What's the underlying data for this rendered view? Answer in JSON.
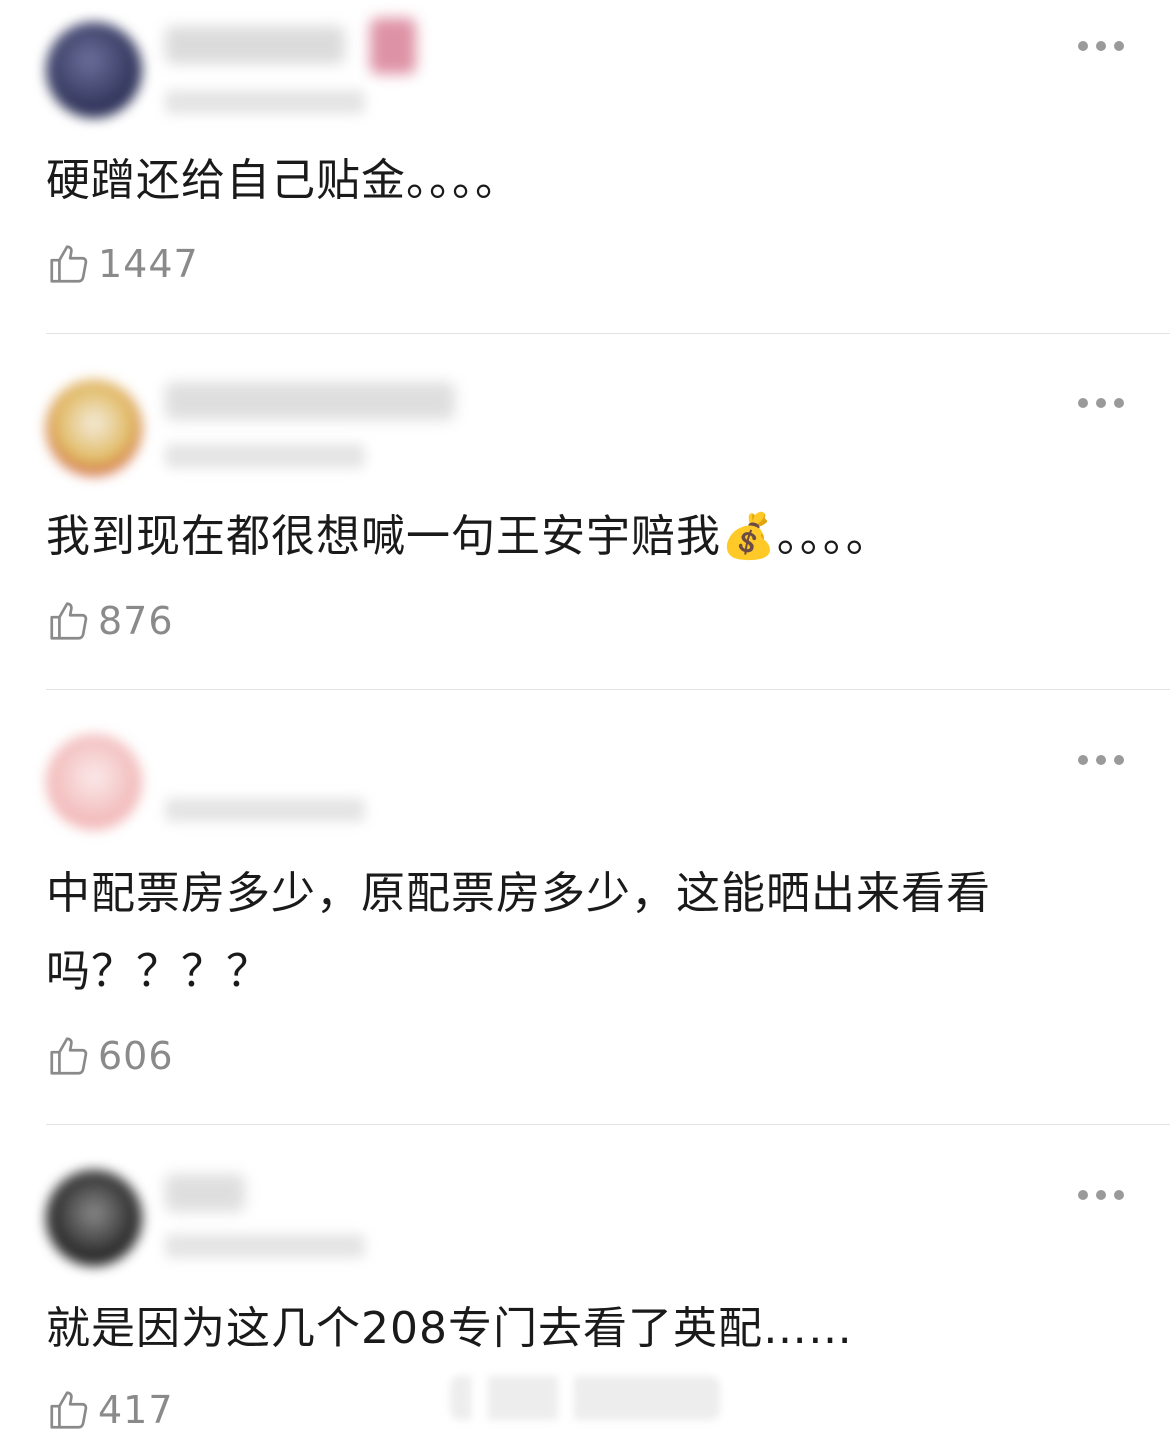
{
  "comments": [
    {
      "text": "硬蹭还给自己贴金。。。。",
      "likes": "1447",
      "more_icon": "more-horizontal-icon",
      "avatar_color": "#3a3f6b"
    },
    {
      "text": "我到现在都很想喊一句王安宇赔我💰。。。。",
      "likes": "876",
      "more_icon": "more-horizontal-icon",
      "avatar_color": "#d9b46a"
    },
    {
      "text": "中配票房多少，原配票房多少，这能晒出来看看吗？？？？",
      "likes": "606",
      "more_icon": "more-horizontal-icon",
      "avatar_color": "#f2c7c7"
    },
    {
      "text": "就是因为这几个208专门去看了英配……",
      "likes": "417",
      "more_icon": "more-horizontal-icon",
      "avatar_color": "#3b3b3b"
    }
  ],
  "like_icon": "thumbs-up-icon",
  "colors": {
    "text": "#1a1a1a",
    "muted": "#8a8a8a",
    "divider": "#e3e3e3"
  }
}
